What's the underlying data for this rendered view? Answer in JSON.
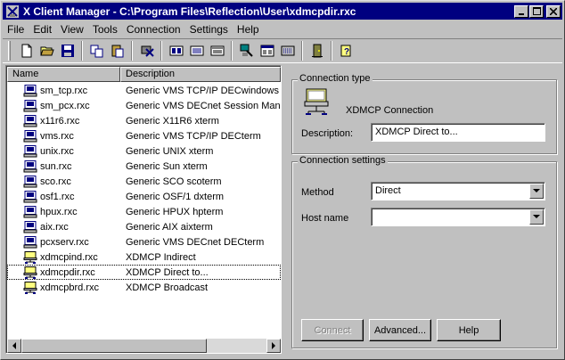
{
  "window": {
    "title": "X Client Manager - C:\\Program Files\\Reflection\\User\\xdmcpdir.rxc"
  },
  "menu": [
    "File",
    "Edit",
    "View",
    "Tools",
    "Connection",
    "Settings",
    "Help"
  ],
  "list": {
    "columns": [
      "Name",
      "Description"
    ],
    "rows": [
      {
        "name": "sm_tcp.rxc",
        "description": "Generic VMS TCP/IP DECwindows S",
        "icon": "terminal-icon"
      },
      {
        "name": "sm_pcx.rxc",
        "description": "Generic VMS DECnet Session Mana",
        "icon": "terminal-icon"
      },
      {
        "name": "x11r6.rxc",
        "description": "Generic X11R6 xterm",
        "icon": "terminal-icon"
      },
      {
        "name": "vms.rxc",
        "description": "Generic VMS TCP/IP DECterm",
        "icon": "terminal-icon"
      },
      {
        "name": "unix.rxc",
        "description": "Generic UNIX xterm",
        "icon": "terminal-icon"
      },
      {
        "name": "sun.rxc",
        "description": "Generic Sun xterm",
        "icon": "terminal-icon"
      },
      {
        "name": "sco.rxc",
        "description": "Generic SCO scoterm",
        "icon": "terminal-icon"
      },
      {
        "name": "osf1.rxc",
        "description": "Generic OSF/1 dxterm",
        "icon": "terminal-icon"
      },
      {
        "name": "hpux.rxc",
        "description": "Generic HPUX hpterm",
        "icon": "terminal-icon"
      },
      {
        "name": "aix.rxc",
        "description": "Generic AIX aixterm",
        "icon": "terminal-icon"
      },
      {
        "name": "pcxserv.rxc",
        "description": "Generic VMS DECnet DECterm",
        "icon": "terminal-icon"
      },
      {
        "name": "xdmcpind.rxc",
        "description": "XDMCP Indirect",
        "icon": "xdmcp-icon"
      },
      {
        "name": "xdmcpdir.rxc",
        "description": "XDMCP Direct to...",
        "icon": "xdmcp-icon"
      },
      {
        "name": "xdmcpbrd.rxc",
        "description": "XDMCP Broadcast",
        "icon": "xdmcp-icon"
      }
    ]
  },
  "connection_type": {
    "group_label": "Connection type",
    "type_name": "XDMCP Connection",
    "description_label": "Description:",
    "description_value": "XDMCP Direct to..."
  },
  "connection_settings": {
    "group_label": "Connection settings",
    "method_label": "Method",
    "method_value": "Direct",
    "host_label": "Host name",
    "host_value": ""
  },
  "buttons": {
    "connect": "Connect",
    "advanced": "Advanced...",
    "help": "Help"
  },
  "colors": {
    "titlebar": "#000080",
    "face": "#c0c0c0",
    "selection_outline": "#000000"
  }
}
